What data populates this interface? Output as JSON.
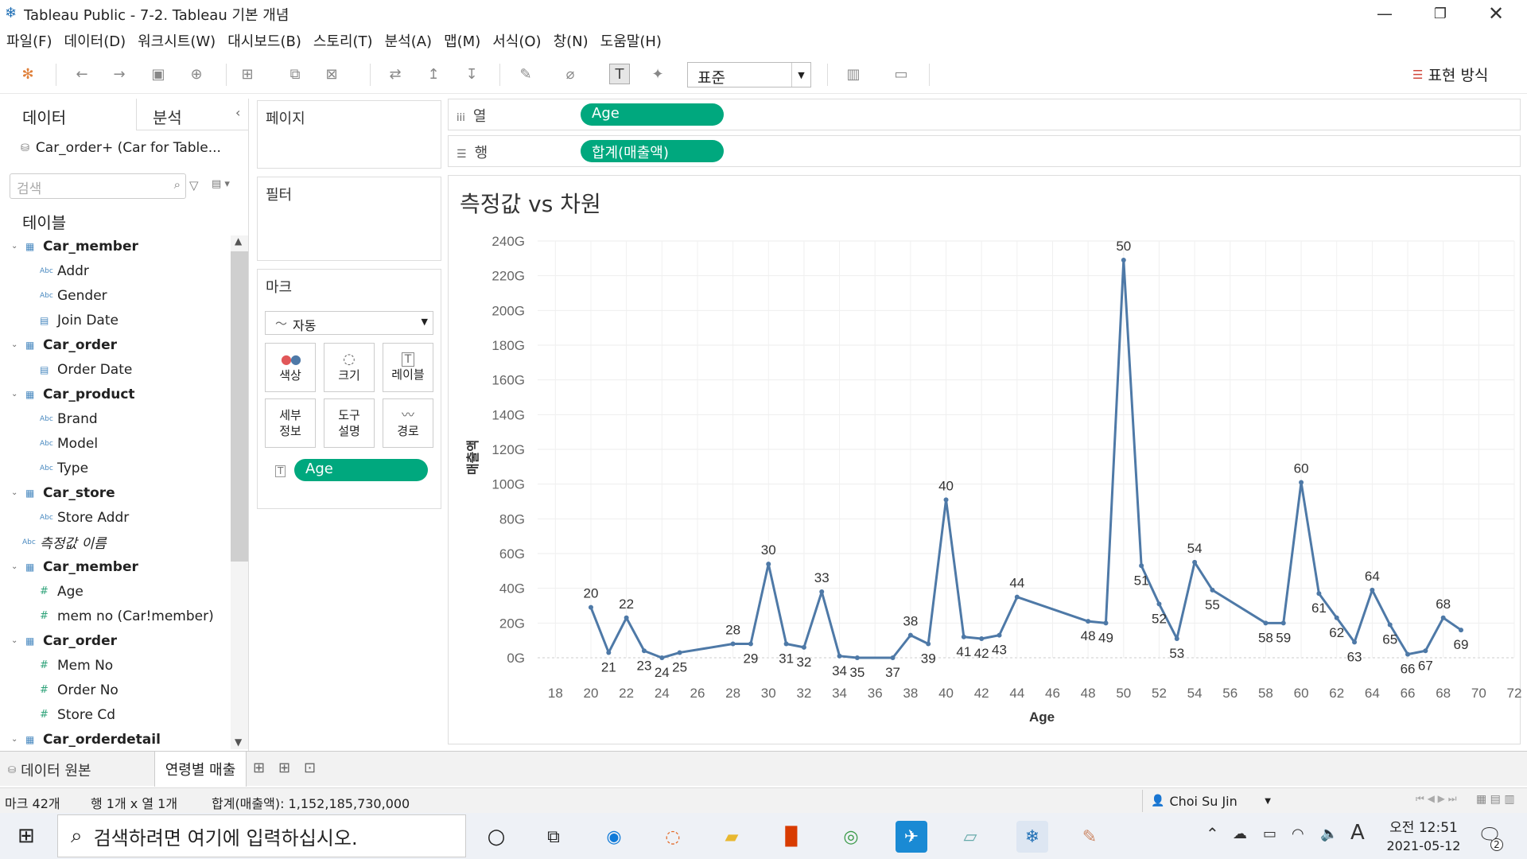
{
  "window": {
    "title": "Tableau Public - 7-2. Tableau 기본 개념"
  },
  "menu": [
    "파일(F)",
    "데이터(D)",
    "워크시트(W)",
    "대시보드(B)",
    "스토리(T)",
    "분석(A)",
    "맵(M)",
    "서식(O)",
    "창(N)",
    "도움말(H)"
  ],
  "toolbar": {
    "fit_value": "표준",
    "show_me_label": "표현 방식"
  },
  "left_panel": {
    "tab_data": "데이터",
    "tab_analysis": "분석",
    "datasource": "Car_order+ (Car for Table...",
    "search_placeholder": "검색",
    "tables_heading": "테이블",
    "tree": [
      {
        "label": "Car_member",
        "kind": "table"
      },
      {
        "label": "Addr",
        "kind": "abc"
      },
      {
        "label": "Gender",
        "kind": "abc"
      },
      {
        "label": "Join Date",
        "kind": "date"
      },
      {
        "label": "Car_order",
        "kind": "table"
      },
      {
        "label": "Order Date",
        "kind": "date"
      },
      {
        "label": "Car_product",
        "kind": "table"
      },
      {
        "label": "Brand",
        "kind": "abc"
      },
      {
        "label": "Model",
        "kind": "abc"
      },
      {
        "label": "Type",
        "kind": "abc"
      },
      {
        "label": "Car_store",
        "kind": "table"
      },
      {
        "label": "Store Addr",
        "kind": "abc"
      },
      {
        "label": "측정값 이름",
        "kind": "measure-names"
      },
      {
        "label": "Car_member",
        "kind": "table"
      },
      {
        "label": "Age",
        "kind": "num"
      },
      {
        "label": "mem no (Car!member)",
        "kind": "num"
      },
      {
        "label": "Car_order",
        "kind": "table"
      },
      {
        "label": "Mem No",
        "kind": "num"
      },
      {
        "label": "Order No",
        "kind": "num"
      },
      {
        "label": "Store Cd",
        "kind": "num"
      },
      {
        "label": "Car_orderdetail",
        "kind": "table"
      }
    ]
  },
  "cards": {
    "pages": "페이지",
    "filters": "필터",
    "marks": "마크",
    "mark_type": "자동",
    "mark_buttons": [
      "색상",
      "크기",
      "레이블",
      "세부\n정보",
      "도구\n설명",
      "경로"
    ],
    "label_pill": "Age"
  },
  "shelves": {
    "columns_label": "열",
    "columns_pill": "Age",
    "rows_label": "행",
    "rows_pill": "합계(매출액)"
  },
  "sheet": {
    "title": "측정값 vs 차원"
  },
  "chart_data": {
    "type": "line",
    "title": "측정값 vs 차원",
    "xlabel": "Age",
    "ylabel": "매출액",
    "xlim": [
      17,
      72
    ],
    "ylim": [
      0,
      240
    ],
    "x_ticks": [
      18,
      20,
      22,
      24,
      26,
      28,
      30,
      32,
      34,
      36,
      38,
      40,
      42,
      44,
      46,
      48,
      50,
      52,
      54,
      56,
      58,
      60,
      62,
      64,
      66,
      68,
      70,
      72
    ],
    "y_ticks": [
      0,
      20,
      40,
      60,
      80,
      100,
      120,
      140,
      160,
      180,
      200,
      220,
      240
    ],
    "y_tick_labels": [
      "0G",
      "20G",
      "40G",
      "60G",
      "80G",
      "100G",
      "120G",
      "140G",
      "160G",
      "180G",
      "200G",
      "220G",
      "240G"
    ],
    "color": "#4e79a7",
    "x": [
      20,
      21,
      22,
      23,
      24,
      25,
      28,
      29,
      30,
      31,
      32,
      33,
      34,
      35,
      37,
      38,
      39,
      40,
      41,
      42,
      43,
      44,
      48,
      49,
      50,
      51,
      52,
      53,
      54,
      55,
      58,
      59,
      60,
      61,
      62,
      63,
      64,
      65,
      66,
      67,
      68,
      69
    ],
    "y": [
      29,
      3,
      23,
      4,
      0,
      3,
      8,
      8,
      54,
      8,
      6,
      38,
      1,
      0,
      0,
      13,
      8,
      91,
      12,
      11,
      13,
      35,
      21,
      20,
      229,
      53,
      31,
      11,
      55,
      39,
      20,
      20,
      101,
      37,
      23,
      9,
      39,
      19,
      2,
      4,
      23,
      16
    ]
  },
  "sheet_tabs": {
    "datasource_tab": "데이터 원본",
    "active_sheet": "연령별 매출"
  },
  "status": {
    "marks": "마크 42개",
    "rows_cols": "행 1개 x 열 1개",
    "sum": "합계(매출액): 1,152,185,730,000",
    "user": "Choi Su Jin"
  },
  "taskbar": {
    "search_placeholder": "검색하려면 여기에 입력하십시오.",
    "time": "오전 12:51",
    "date": "2021-05-12",
    "ime": "A",
    "notif_count": "2"
  }
}
